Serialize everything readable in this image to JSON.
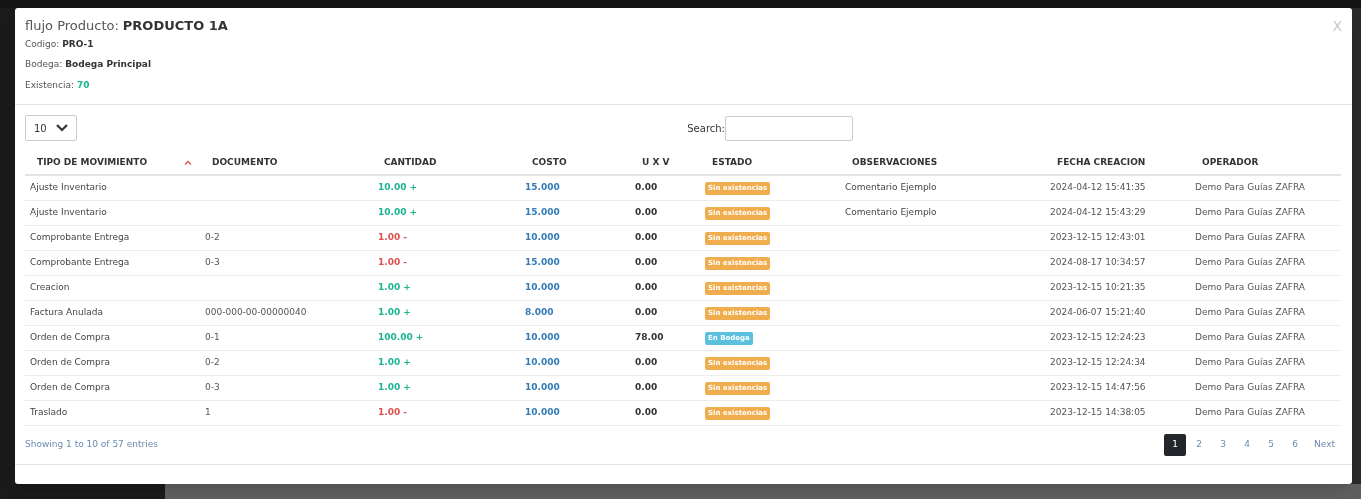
{
  "dialog": {
    "title_label": "flujo Producto:",
    "title_value": "PRODUCTO 1A",
    "close": "X",
    "fields": [
      {
        "label": "Codigo:",
        "value": "PRO-1",
        "kind": "plain"
      },
      {
        "label": "Bodega:",
        "value": "Bodega Principal",
        "kind": "plain"
      },
      {
        "label": "Existencia:",
        "value": "70",
        "kind": "highlight"
      }
    ]
  },
  "page_size": {
    "value": "10"
  },
  "search": {
    "label": "Search:"
  },
  "table": {
    "columns": [
      {
        "label": "TIPO DE MOVIMIENTO",
        "sorted": true
      },
      {
        "label": "DOCUMENTO",
        "sorted": false
      },
      {
        "label": "CANTIDAD",
        "sorted": false
      },
      {
        "label": "COSTO",
        "sorted": false
      },
      {
        "label": "U X V",
        "sorted": false
      },
      {
        "label": "ESTADO",
        "sorted": false
      },
      {
        "label": "OBSERVACIONES",
        "sorted": false
      },
      {
        "label": "FECHA CREACION",
        "sorted": false
      },
      {
        "label": "OPERADOR",
        "sorted": false
      }
    ],
    "rows": [
      {
        "tipo": "Ajuste Inventario",
        "documento": "",
        "cantidad": "10.00 +",
        "kind": "in",
        "costo": "15.000",
        "uxv": "0.00",
        "estado": "Sin existencias",
        "color": "#f0ad4e",
        "observaciones": "Comentario Ejemplo",
        "fecha": "2024-04-12 15:41:35",
        "operador": "Demo Para Guías ZAFRA"
      },
      {
        "tipo": "Ajuste Inventario",
        "documento": "",
        "cantidad": "10.00 +",
        "kind": "in",
        "costo": "15.000",
        "uxv": "0.00",
        "estado": "Sin existencias",
        "color": "#f0ad4e",
        "observaciones": "Comentario Ejemplo",
        "fecha": "2024-04-12 15:43:29",
        "operador": "Demo Para Guías ZAFRA"
      },
      {
        "tipo": "Comprobante Entrega",
        "documento": "0-2",
        "cantidad": "1.00 -",
        "kind": "out",
        "costo": "10.000",
        "uxv": "0.00",
        "estado": "Sin existencias",
        "color": "#f0ad4e",
        "observaciones": "",
        "fecha": "2023-12-15 12:43:01",
        "operador": "Demo Para Guías ZAFRA"
      },
      {
        "tipo": "Comprobante Entrega",
        "documento": "0-3",
        "cantidad": "1.00 -",
        "kind": "out",
        "costo": "15.000",
        "uxv": "0.00",
        "estado": "Sin existencias",
        "color": "#f0ad4e",
        "observaciones": "",
        "fecha": "2024-08-17 10:34:57",
        "operador": "Demo Para Guías ZAFRA"
      },
      {
        "tipo": "Creacion",
        "documento": "",
        "cantidad": "1.00 +",
        "kind": "in",
        "costo": "10.000",
        "uxv": "0.00",
        "estado": "Sin existencias",
        "color": "#f0ad4e",
        "observaciones": "",
        "fecha": "2023-12-15 10:21:35",
        "operador": "Demo Para Guías ZAFRA"
      },
      {
        "tipo": "Factura Anulada",
        "documento": "000-000-00-00000040",
        "cantidad": "1.00 +",
        "kind": "in",
        "costo": "8.000",
        "uxv": "0.00",
        "estado": "Sin existencias",
        "color": "#f0ad4e",
        "observaciones": "",
        "fecha": "2024-06-07 15:21:40",
        "operador": "Demo Para Guías ZAFRA"
      },
      {
        "tipo": "Orden de Compra",
        "documento": "0-1",
        "cantidad": "100.00 +",
        "kind": "in",
        "costo": "10.000",
        "uxv": "78.00",
        "estado": "En Bodega",
        "color": "#5bc0de",
        "observaciones": "",
        "fecha": "2023-12-15 12:24:23",
        "operador": "Demo Para Guías ZAFRA"
      },
      {
        "tipo": "Orden de Compra",
        "documento": "0-2",
        "cantidad": "1.00 +",
        "kind": "in",
        "costo": "10.000",
        "uxv": "0.00",
        "estado": "Sin existencias",
        "color": "#f0ad4e",
        "observaciones": "",
        "fecha": "2023-12-15 12:24:34",
        "operador": "Demo Para Guías ZAFRA"
      },
      {
        "tipo": "Orden de Compra",
        "documento": "0-3",
        "cantidad": "1.00 +",
        "kind": "in",
        "costo": "10.000",
        "uxv": "0.00",
        "estado": "Sin existencias",
        "color": "#f0ad4e",
        "observaciones": "",
        "fecha": "2023-12-15 14:47:56",
        "operador": "Demo Para Guías ZAFRA"
      },
      {
        "tipo": "Traslado",
        "documento": "1",
        "cantidad": "1.00 -",
        "kind": "out",
        "costo": "10.000",
        "uxv": "0.00",
        "estado": "Sin existencias",
        "color": "#f0ad4e",
        "observaciones": "",
        "fecha": "2023-12-15 14:38:05",
        "operador": "Demo Para Guías ZAFRA"
      }
    ]
  },
  "info": "Showing 1 to 10 of 57 entries",
  "pagination": [
    {
      "label": "1",
      "selected": true
    },
    {
      "label": "2",
      "selected": false
    },
    {
      "label": "3",
      "selected": false
    },
    {
      "label": "4",
      "selected": false
    },
    {
      "label": "5",
      "selected": false
    },
    {
      "label": "6",
      "selected": false
    },
    {
      "label": "Next",
      "selected": false
    }
  ]
}
